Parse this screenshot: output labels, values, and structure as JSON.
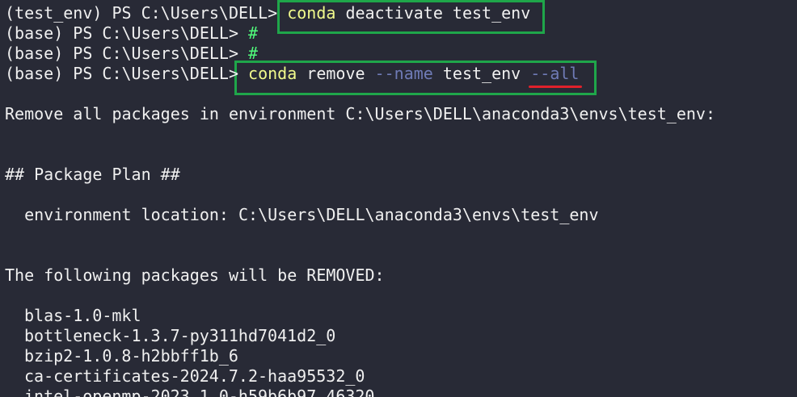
{
  "terminal": {
    "line1": {
      "prompt": "(test_env) PS C:\\Users\\DELL> ",
      "cmd": "conda",
      "rest": " deactivate test_env"
    },
    "line2": {
      "prompt": "(base) PS C:\\Users\\DELL> ",
      "hash": "#"
    },
    "line3": {
      "prompt": "(base) PS C:\\Users\\DELL> ",
      "hash": "#"
    },
    "line4": {
      "prompt": "(base) PS C:\\Users\\DELL> ",
      "cmd": "conda",
      "rest1": " remove ",
      "flag1": "--name",
      "rest2": " test_env ",
      "flag2": "--all"
    },
    "remove_msg": "Remove all packages in environment C:\\Users\\DELL\\anaconda3\\envs\\test_env:",
    "plan_header": "## Package Plan ##",
    "env_location": "  environment location: C:\\Users\\DELL\\anaconda3\\envs\\test_env",
    "removed_header": "The following packages will be REMOVED:",
    "packages": [
      "blas-1.0-mkl",
      "bottleneck-1.3.7-py311hd7041d2_0",
      "bzip2-1.0.8-h2bbff1b_6",
      "ca-certificates-2024.7.2-haa95532_0",
      "intel-openmp-2023.1.0-h59b6b97_46320"
    ]
  },
  "colors": {
    "background": "#282a36",
    "highlight_box": "#1fa64a",
    "underline": "#e0212b",
    "command": "#f1fa8c",
    "flag": "#6f7bb6",
    "hash": "#50fa7b"
  }
}
